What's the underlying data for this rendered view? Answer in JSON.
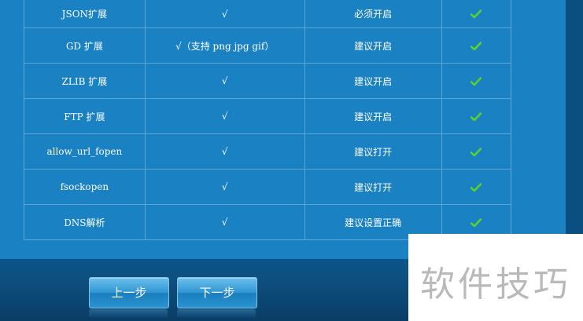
{
  "table": {
    "rows": [
      {
        "name": "JSON扩展",
        "requirement": "√",
        "recommendation": "必须开启",
        "status": "check-icon"
      },
      {
        "name": "GD 扩展",
        "requirement": "√（支持 png jpg gif）",
        "recommendation": "建议开启",
        "status": "check-icon"
      },
      {
        "name": "ZLIB 扩展",
        "requirement": "√",
        "recommendation": "建议开启",
        "status": "check-icon"
      },
      {
        "name": "FTP 扩展",
        "requirement": "√",
        "recommendation": "建议开启",
        "status": "check-icon"
      },
      {
        "name": "allow_url_fopen",
        "requirement": "√",
        "recommendation": "建议打开",
        "status": "check-icon"
      },
      {
        "name": "fsockopen",
        "requirement": "√",
        "recommendation": "建议打开",
        "status": "check-icon"
      },
      {
        "name": "DNS解析",
        "requirement": "√",
        "recommendation": "建议设置正确",
        "status": "check-icon"
      }
    ]
  },
  "buttons": {
    "prev_label": "上一步",
    "next_label": "下一步"
  },
  "watermark": {
    "text": "软件技巧"
  },
  "colors": {
    "panel": "#1a81c3",
    "check": "#5cd12c",
    "border": "#5ea6d8"
  }
}
